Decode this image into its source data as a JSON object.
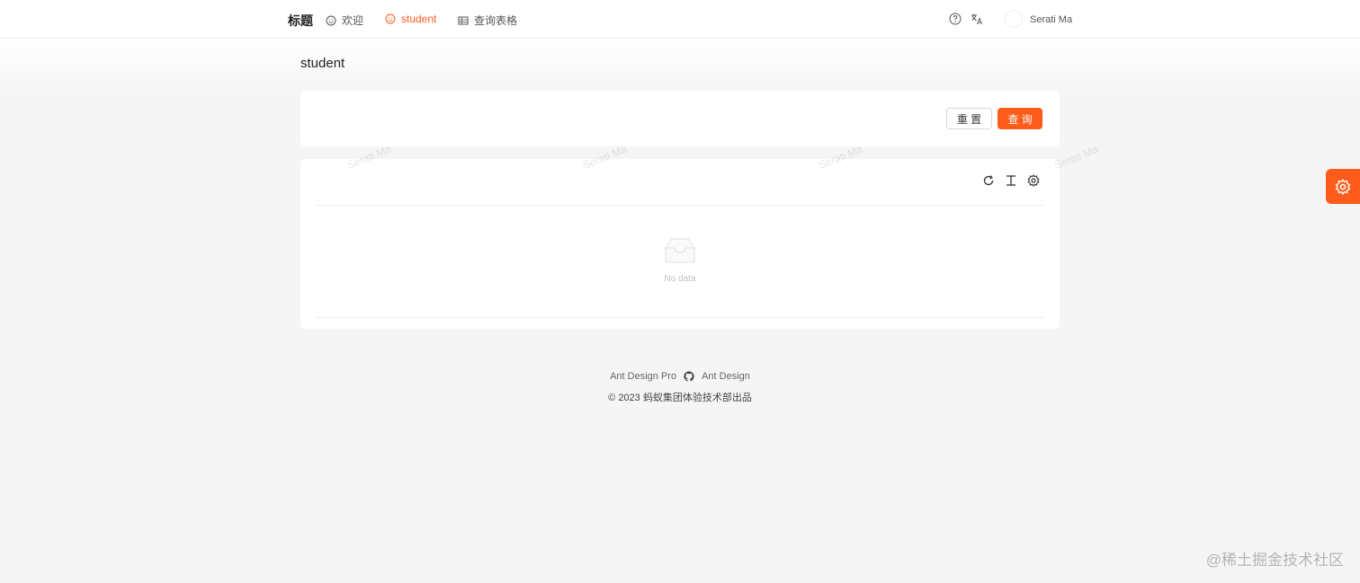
{
  "header": {
    "brand": "标题",
    "nav": [
      {
        "label": "欢迎",
        "icon": "smile-icon"
      },
      {
        "label": "student",
        "icon": "smile-icon",
        "active": true
      },
      {
        "label": "查询表格",
        "icon": "table-icon"
      }
    ],
    "username": "Serati Ma"
  },
  "page": {
    "title": "student"
  },
  "search_form": {
    "reset_label": "重 置",
    "query_label": "查 询"
  },
  "table": {
    "empty_text": "No data"
  },
  "watermark": "Serati Ma",
  "footer": {
    "link1": "Ant Design Pro",
    "link2": "Ant Design",
    "copyright": "2023 蚂蚁集团体验技术部出品"
  },
  "corner_watermark": "@稀土掘金技术社区",
  "colors": {
    "accent": "#ff5b1a",
    "background": "#f5f5f5"
  }
}
